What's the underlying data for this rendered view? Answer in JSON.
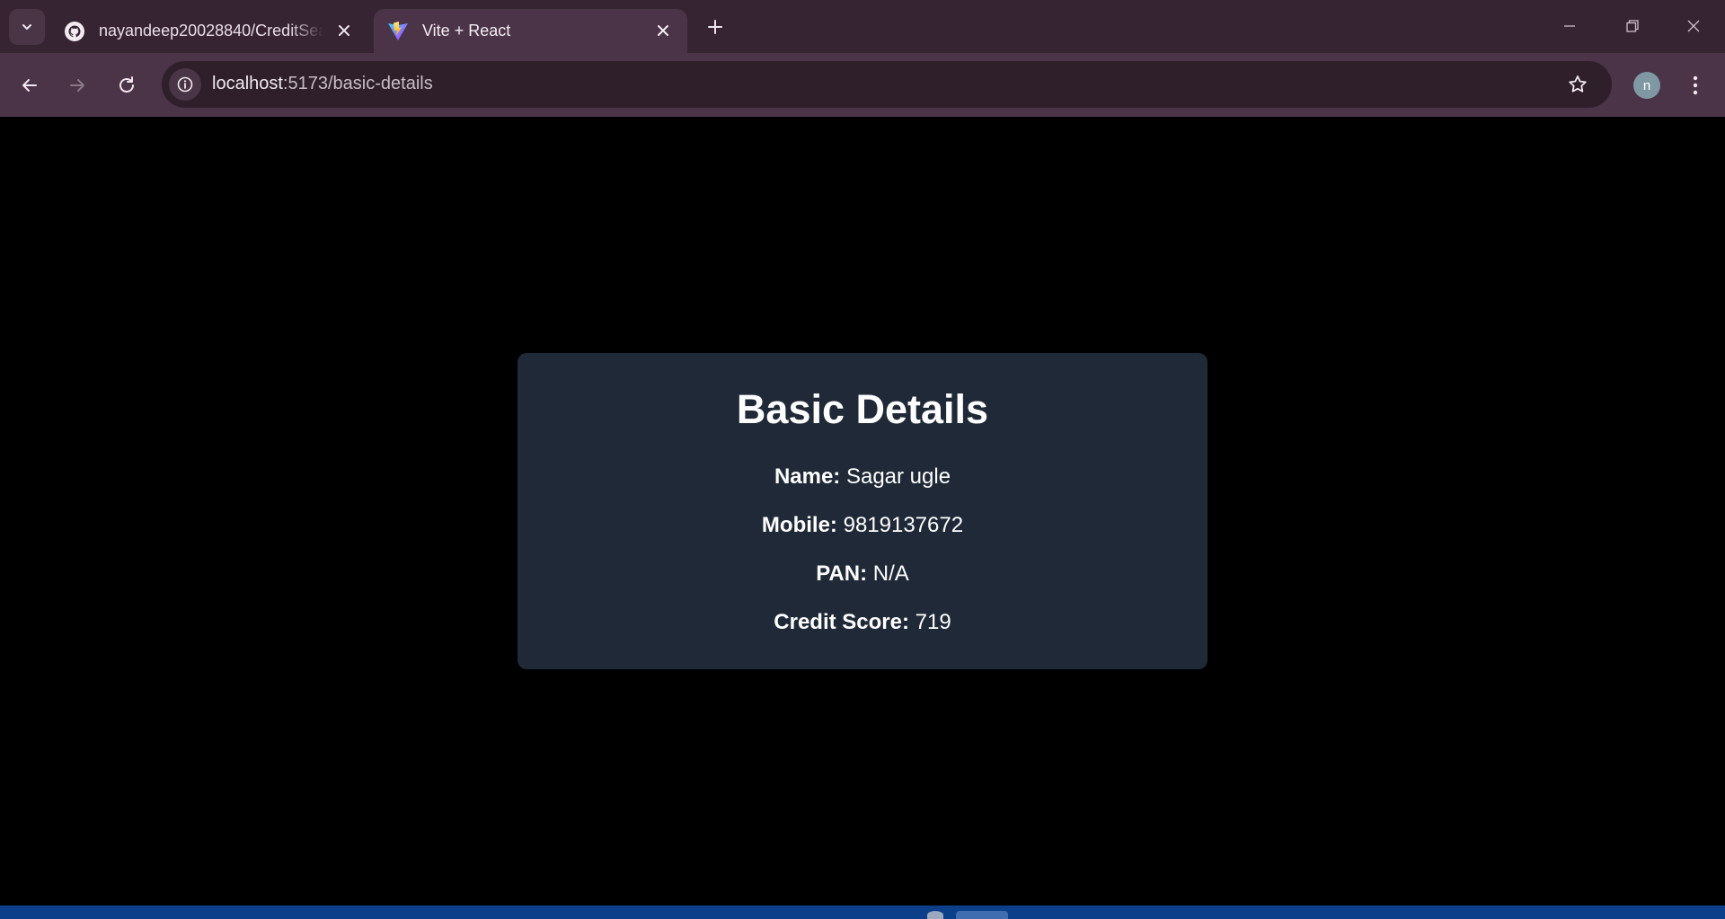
{
  "browser": {
    "tabs": [
      {
        "title": "nayandeep20028840/CreditSea",
        "favicon": "github-icon",
        "active": false
      },
      {
        "title": "Vite + React",
        "favicon": "vite-icon",
        "active": true
      }
    ],
    "url_host": "localhost",
    "url_path": ":5173/basic-details",
    "profile_initial": "n"
  },
  "page": {
    "title": "Basic Details",
    "fields": [
      {
        "label": "Name:",
        "value": "Sagar ugle"
      },
      {
        "label": "Mobile:",
        "value": "9819137672"
      },
      {
        "label": "PAN:",
        "value": "N/A"
      },
      {
        "label": "Credit Score:",
        "value": "719"
      }
    ]
  },
  "colors": {
    "page_background": "#000000",
    "card_background": "#1f2937",
    "chrome_frame": "#362433",
    "chrome_toolbar": "#4b3348"
  }
}
